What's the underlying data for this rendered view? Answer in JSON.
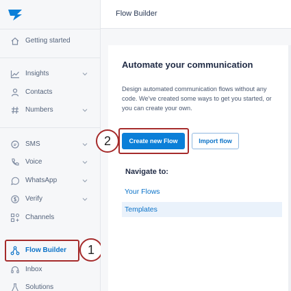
{
  "colors": {
    "accent": "#0b7fd8",
    "link": "#0a72c8",
    "annotation": "#a52a2a",
    "sidebar_bg": "#f6f7f9"
  },
  "sidebar": {
    "logo_icon": "brand-logo-icon",
    "items": [
      {
        "label": "Getting started",
        "icon": "home-icon"
      },
      {
        "label": "Insights",
        "icon": "chart-line-icon",
        "expandable": true
      },
      {
        "label": "Contacts",
        "icon": "person-icon"
      },
      {
        "label": "Numbers",
        "icon": "hash-icon",
        "expandable": true
      },
      {
        "label": "SMS",
        "icon": "chat-bubble-icon",
        "expandable": true
      },
      {
        "label": "Voice",
        "icon": "phone-icon",
        "expandable": true
      },
      {
        "label": "WhatsApp",
        "icon": "whatsapp-icon",
        "expandable": true
      },
      {
        "label": "Verify",
        "icon": "dollar-circle-icon",
        "expandable": true
      },
      {
        "label": "Channels",
        "icon": "channels-grid-icon"
      },
      {
        "label": "Flow Builder",
        "icon": "flow-nodes-icon",
        "active": true
      },
      {
        "label": "Inbox",
        "icon": "headset-icon"
      },
      {
        "label": "Solutions",
        "icon": "flask-icon"
      }
    ]
  },
  "header": {
    "title": "Flow Builder"
  },
  "main": {
    "heading": "Automate your communication",
    "description": "Design automated communication flows without any code. We've created some ways to get you started, or you can create your own.",
    "create_button": "Create new Flow",
    "import_button": "Import flow",
    "navigate_heading": "Navigate to:",
    "links": [
      "Your Flows",
      "Templates"
    ]
  },
  "annotations": {
    "step1": "1",
    "step2": "2"
  }
}
